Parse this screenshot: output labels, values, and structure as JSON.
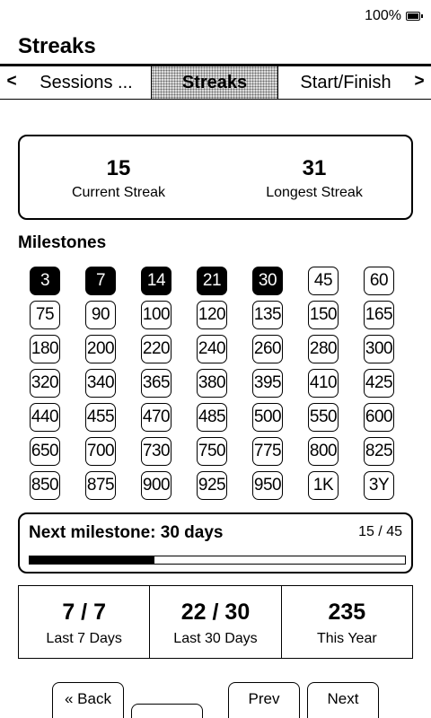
{
  "status": {
    "battery_label": "100%",
    "battery_icon": "battery-charging-icon"
  },
  "page_title": "Streaks",
  "tabs": {
    "prev_arrow": "<",
    "next_arrow": ">",
    "items": [
      {
        "label": "Sessions ..."
      },
      {
        "label": "Streaks",
        "selected": true
      },
      {
        "label": "Start/Finish"
      }
    ]
  },
  "stats": {
    "current_value": "15",
    "current_label": "Current Streak",
    "longest_value": "31",
    "longest_label": "Longest Streak"
  },
  "milestones_title": "Milestones",
  "milestones": [
    {
      "label": "3",
      "done": true
    },
    {
      "label": "7",
      "done": true
    },
    {
      "label": "14",
      "done": true
    },
    {
      "label": "21",
      "done": true
    },
    {
      "label": "30",
      "done": true
    },
    {
      "label": "45",
      "done": false
    },
    {
      "label": "60",
      "done": false
    },
    {
      "label": "75",
      "done": false
    },
    {
      "label": "90",
      "done": false
    },
    {
      "label": "100",
      "done": false
    },
    {
      "label": "120",
      "done": false
    },
    {
      "label": "135",
      "done": false
    },
    {
      "label": "150",
      "done": false
    },
    {
      "label": "165",
      "done": false
    },
    {
      "label": "180",
      "done": false
    },
    {
      "label": "200",
      "done": false
    },
    {
      "label": "220",
      "done": false
    },
    {
      "label": "240",
      "done": false
    },
    {
      "label": "260",
      "done": false
    },
    {
      "label": "280",
      "done": false
    },
    {
      "label": "300",
      "done": false
    },
    {
      "label": "320",
      "done": false
    },
    {
      "label": "340",
      "done": false
    },
    {
      "label": "365",
      "done": false
    },
    {
      "label": "380",
      "done": false
    },
    {
      "label": "395",
      "done": false
    },
    {
      "label": "410",
      "done": false
    },
    {
      "label": "425",
      "done": false
    },
    {
      "label": "440",
      "done": false
    },
    {
      "label": "455",
      "done": false
    },
    {
      "label": "470",
      "done": false
    },
    {
      "label": "485",
      "done": false
    },
    {
      "label": "500",
      "done": false
    },
    {
      "label": "550",
      "done": false
    },
    {
      "label": "600",
      "done": false
    },
    {
      "label": "650",
      "done": false
    },
    {
      "label": "700",
      "done": false
    },
    {
      "label": "730",
      "done": false
    },
    {
      "label": "750",
      "done": false
    },
    {
      "label": "775",
      "done": false
    },
    {
      "label": "800",
      "done": false
    },
    {
      "label": "825",
      "done": false
    },
    {
      "label": "850",
      "done": false
    },
    {
      "label": "875",
      "done": false
    },
    {
      "label": "900",
      "done": false
    },
    {
      "label": "925",
      "done": false
    },
    {
      "label": "950",
      "done": false
    },
    {
      "label": "1K",
      "done": false
    },
    {
      "label": "3Y",
      "done": false
    }
  ],
  "next_milestone": {
    "title": "Next milestone: 30 days",
    "count": "15 / 45",
    "progress": 0.333
  },
  "summary": [
    {
      "value": "7 / 7",
      "label": "Last 7 Days"
    },
    {
      "value": "22 / 30",
      "label": "Last 30 Days"
    },
    {
      "value": "235",
      "label": "This Year"
    }
  ],
  "buttons": {
    "back": "« Back",
    "middle": "",
    "prev": "Prev",
    "next": "Next"
  }
}
